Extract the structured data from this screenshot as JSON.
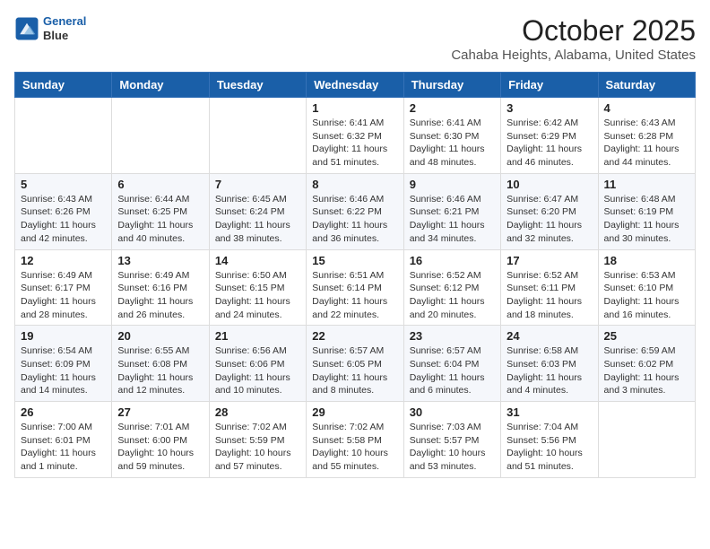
{
  "logo": {
    "line1": "General",
    "line2": "Blue"
  },
  "title": "October 2025",
  "location": "Cahaba Heights, Alabama, United States",
  "days_of_week": [
    "Sunday",
    "Monday",
    "Tuesday",
    "Wednesday",
    "Thursday",
    "Friday",
    "Saturday"
  ],
  "weeks": [
    [
      {
        "day": "",
        "sunrise": "",
        "sunset": "",
        "daylight": ""
      },
      {
        "day": "",
        "sunrise": "",
        "sunset": "",
        "daylight": ""
      },
      {
        "day": "",
        "sunrise": "",
        "sunset": "",
        "daylight": ""
      },
      {
        "day": "1",
        "sunrise": "Sunrise: 6:41 AM",
        "sunset": "Sunset: 6:32 PM",
        "daylight": "Daylight: 11 hours and 51 minutes."
      },
      {
        "day": "2",
        "sunrise": "Sunrise: 6:41 AM",
        "sunset": "Sunset: 6:30 PM",
        "daylight": "Daylight: 11 hours and 48 minutes."
      },
      {
        "day": "3",
        "sunrise": "Sunrise: 6:42 AM",
        "sunset": "Sunset: 6:29 PM",
        "daylight": "Daylight: 11 hours and 46 minutes."
      },
      {
        "day": "4",
        "sunrise": "Sunrise: 6:43 AM",
        "sunset": "Sunset: 6:28 PM",
        "daylight": "Daylight: 11 hours and 44 minutes."
      }
    ],
    [
      {
        "day": "5",
        "sunrise": "Sunrise: 6:43 AM",
        "sunset": "Sunset: 6:26 PM",
        "daylight": "Daylight: 11 hours and 42 minutes."
      },
      {
        "day": "6",
        "sunrise": "Sunrise: 6:44 AM",
        "sunset": "Sunset: 6:25 PM",
        "daylight": "Daylight: 11 hours and 40 minutes."
      },
      {
        "day": "7",
        "sunrise": "Sunrise: 6:45 AM",
        "sunset": "Sunset: 6:24 PM",
        "daylight": "Daylight: 11 hours and 38 minutes."
      },
      {
        "day": "8",
        "sunrise": "Sunrise: 6:46 AM",
        "sunset": "Sunset: 6:22 PM",
        "daylight": "Daylight: 11 hours and 36 minutes."
      },
      {
        "day": "9",
        "sunrise": "Sunrise: 6:46 AM",
        "sunset": "Sunset: 6:21 PM",
        "daylight": "Daylight: 11 hours and 34 minutes."
      },
      {
        "day": "10",
        "sunrise": "Sunrise: 6:47 AM",
        "sunset": "Sunset: 6:20 PM",
        "daylight": "Daylight: 11 hours and 32 minutes."
      },
      {
        "day": "11",
        "sunrise": "Sunrise: 6:48 AM",
        "sunset": "Sunset: 6:19 PM",
        "daylight": "Daylight: 11 hours and 30 minutes."
      }
    ],
    [
      {
        "day": "12",
        "sunrise": "Sunrise: 6:49 AM",
        "sunset": "Sunset: 6:17 PM",
        "daylight": "Daylight: 11 hours and 28 minutes."
      },
      {
        "day": "13",
        "sunrise": "Sunrise: 6:49 AM",
        "sunset": "Sunset: 6:16 PM",
        "daylight": "Daylight: 11 hours and 26 minutes."
      },
      {
        "day": "14",
        "sunrise": "Sunrise: 6:50 AM",
        "sunset": "Sunset: 6:15 PM",
        "daylight": "Daylight: 11 hours and 24 minutes."
      },
      {
        "day": "15",
        "sunrise": "Sunrise: 6:51 AM",
        "sunset": "Sunset: 6:14 PM",
        "daylight": "Daylight: 11 hours and 22 minutes."
      },
      {
        "day": "16",
        "sunrise": "Sunrise: 6:52 AM",
        "sunset": "Sunset: 6:12 PM",
        "daylight": "Daylight: 11 hours and 20 minutes."
      },
      {
        "day": "17",
        "sunrise": "Sunrise: 6:52 AM",
        "sunset": "Sunset: 6:11 PM",
        "daylight": "Daylight: 11 hours and 18 minutes."
      },
      {
        "day": "18",
        "sunrise": "Sunrise: 6:53 AM",
        "sunset": "Sunset: 6:10 PM",
        "daylight": "Daylight: 11 hours and 16 minutes."
      }
    ],
    [
      {
        "day": "19",
        "sunrise": "Sunrise: 6:54 AM",
        "sunset": "Sunset: 6:09 PM",
        "daylight": "Daylight: 11 hours and 14 minutes."
      },
      {
        "day": "20",
        "sunrise": "Sunrise: 6:55 AM",
        "sunset": "Sunset: 6:08 PM",
        "daylight": "Daylight: 11 hours and 12 minutes."
      },
      {
        "day": "21",
        "sunrise": "Sunrise: 6:56 AM",
        "sunset": "Sunset: 6:06 PM",
        "daylight": "Daylight: 11 hours and 10 minutes."
      },
      {
        "day": "22",
        "sunrise": "Sunrise: 6:57 AM",
        "sunset": "Sunset: 6:05 PM",
        "daylight": "Daylight: 11 hours and 8 minutes."
      },
      {
        "day": "23",
        "sunrise": "Sunrise: 6:57 AM",
        "sunset": "Sunset: 6:04 PM",
        "daylight": "Daylight: 11 hours and 6 minutes."
      },
      {
        "day": "24",
        "sunrise": "Sunrise: 6:58 AM",
        "sunset": "Sunset: 6:03 PM",
        "daylight": "Daylight: 11 hours and 4 minutes."
      },
      {
        "day": "25",
        "sunrise": "Sunrise: 6:59 AM",
        "sunset": "Sunset: 6:02 PM",
        "daylight": "Daylight: 11 hours and 3 minutes."
      }
    ],
    [
      {
        "day": "26",
        "sunrise": "Sunrise: 7:00 AM",
        "sunset": "Sunset: 6:01 PM",
        "daylight": "Daylight: 11 hours and 1 minute."
      },
      {
        "day": "27",
        "sunrise": "Sunrise: 7:01 AM",
        "sunset": "Sunset: 6:00 PM",
        "daylight": "Daylight: 10 hours and 59 minutes."
      },
      {
        "day": "28",
        "sunrise": "Sunrise: 7:02 AM",
        "sunset": "Sunset: 5:59 PM",
        "daylight": "Daylight: 10 hours and 57 minutes."
      },
      {
        "day": "29",
        "sunrise": "Sunrise: 7:02 AM",
        "sunset": "Sunset: 5:58 PM",
        "daylight": "Daylight: 10 hours and 55 minutes."
      },
      {
        "day": "30",
        "sunrise": "Sunrise: 7:03 AM",
        "sunset": "Sunset: 5:57 PM",
        "daylight": "Daylight: 10 hours and 53 minutes."
      },
      {
        "day": "31",
        "sunrise": "Sunrise: 7:04 AM",
        "sunset": "Sunset: 5:56 PM",
        "daylight": "Daylight: 10 hours and 51 minutes."
      },
      {
        "day": "",
        "sunrise": "",
        "sunset": "",
        "daylight": ""
      }
    ]
  ]
}
